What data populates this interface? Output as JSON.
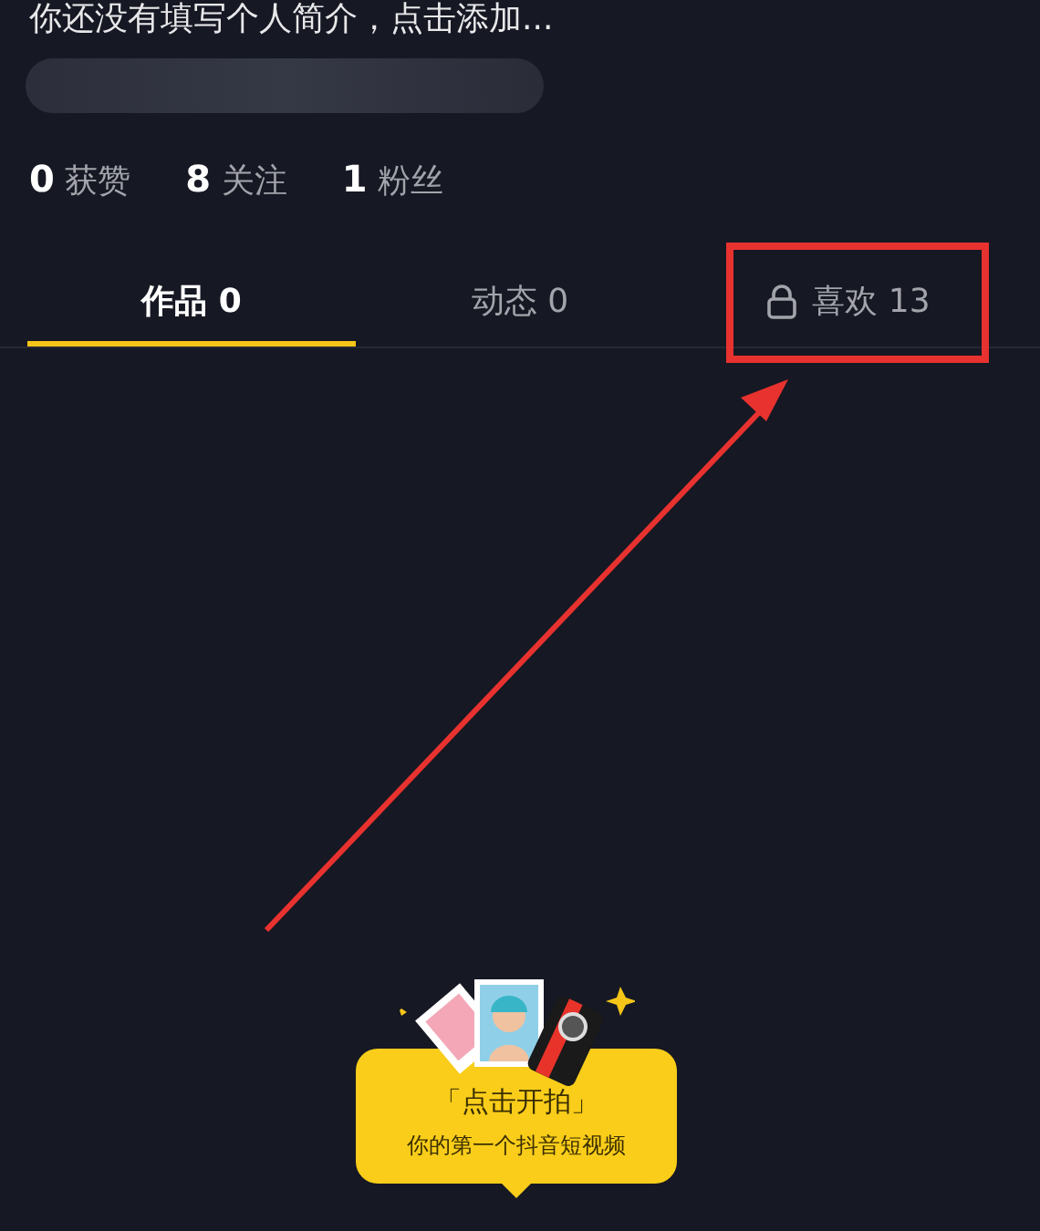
{
  "profile": {
    "bio": "你还没有填写个人简介，点击添加...",
    "stats": [
      "**0** 获赞",
      "**8** 关注",
      "**1** 粉丝"
    ]
  },
  "tabs": [
    {
      "label": "作品 0",
      "selected": true,
      "locked": false
    },
    {
      "label": "动态 0",
      "selected": false,
      "locked": false
    },
    {
      "label": "喜欢 13",
      "selected": false,
      "locked": true
    }
  ],
  "prompt": {
    "title": "「点击开拍」",
    "subtitle": "你的第一个抖音短视频"
  }
}
